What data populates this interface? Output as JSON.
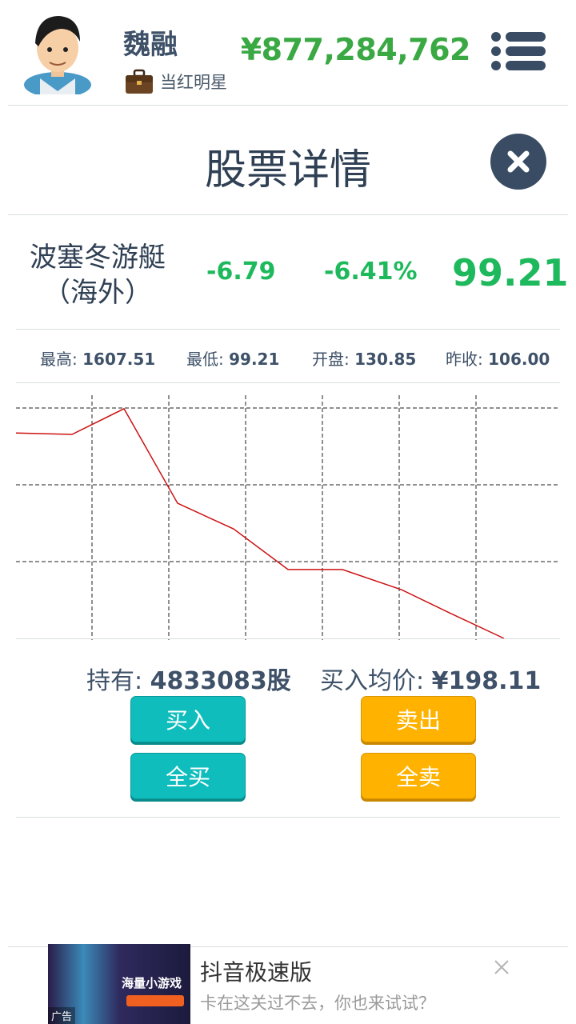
{
  "player": {
    "name": "魏融",
    "title": "当红明星",
    "money": "¥877,284,762"
  },
  "panel": {
    "title": "股票详情"
  },
  "stock": {
    "name": "波塞冬游艇（海外）",
    "change": "-6.79",
    "change_pct": "-6.41%",
    "price": "99.21"
  },
  "stats": {
    "high_label": "最高:",
    "high": "1607.51",
    "low_label": "最低:",
    "low": "99.21",
    "open_label": "开盘:",
    "open": "130.85",
    "prev_label": "昨收:",
    "prev": "106.00"
  },
  "chart_data": {
    "type": "line",
    "x": [
      0,
      1,
      2,
      3,
      4,
      5,
      6,
      7,
      8,
      9
    ],
    "series": [
      {
        "values": [
          106.0,
          105.5,
          115.0,
          80.0,
          70.5,
          55.5,
          55.5,
          48.0,
          39.0,
          30.0
        ]
      }
    ],
    "ylim": [
      30,
      120
    ],
    "grid": true,
    "line_color": "#cc1111"
  },
  "holdings": {
    "shares_label": "持有:",
    "shares": "4833083股",
    "avg_label": "买入均价:",
    "avg": "¥198.11"
  },
  "actions": {
    "buy": "买入",
    "sell": "卖出",
    "buy_all": "全买",
    "sell_all": "全卖"
  },
  "ad": {
    "title": "抖音极速版",
    "description": "卡在这关过不去，你也来试试？",
    "thumb_text": "海量小游戏",
    "tag": "广告"
  },
  "colors": {
    "money": "#3aa843",
    "down": "#1fb95d",
    "buy": "#0fbdbd",
    "sell": "#ffb300"
  }
}
